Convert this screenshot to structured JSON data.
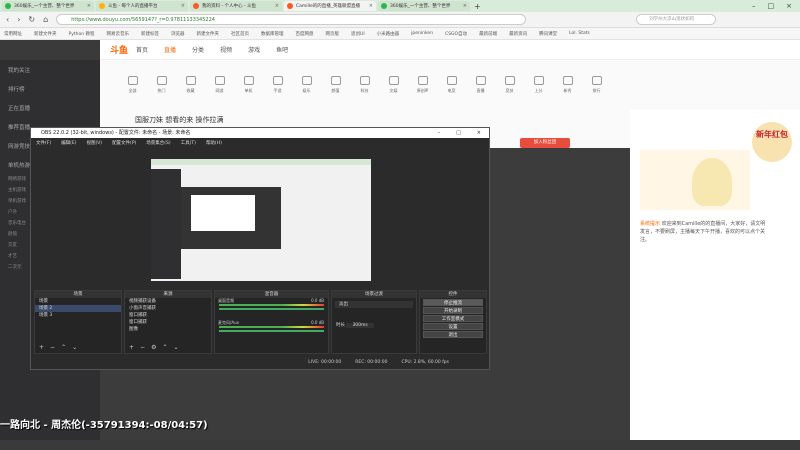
{
  "tabs": [
    {
      "title": "360娱乐_一个主营、整个世界",
      "color": "#2db84d"
    },
    {
      "title": "斗鱼 - 每个人的直播平台",
      "color": "#ffb300"
    },
    {
      "title": "我的资料 - 个人中心 - 斗鱼",
      "color": "#ff5722"
    },
    {
      "title": "Camille的的直播_英雄联盟直播",
      "color": "#ff5722"
    },
    {
      "title": "360娱乐_一个主营、整个世界",
      "color": "#2db84d"
    }
  ],
  "address": {
    "url": "https://www.douyu.com/5659147?_r=0.97811133345224",
    "search_placeholder": "刘学州大凉山现状如何"
  },
  "bookmarks": [
    "常用网址",
    "新建文件夹",
    "Python 教程",
    "网易云音乐",
    "新建标签",
    "浏览器",
    "新建文件夹",
    "社区首页",
    "数据库管理",
    "百度网盘",
    "网页版",
    "思创UI",
    "小米路由器",
    "jpeninken",
    "CSGO自动",
    "最新前端",
    "最新资讯",
    "腾讯课堂",
    "Lol. Stats"
  ],
  "header": {
    "logo": "斗鱼",
    "nav": [
      "首页",
      "直播",
      "分类",
      "视频",
      "游戏",
      "鱼吧"
    ]
  },
  "leftnav": {
    "items": [
      "我的关注",
      "排行榜",
      "正在直播",
      "推荐直播",
      "网游竞技",
      "单机热游"
    ],
    "subs": [
      "网络游戏",
      "主机游戏",
      "单机游戏",
      "户外",
      "音乐电台",
      "颜值",
      "交友",
      "才艺",
      "二次元"
    ]
  },
  "categories": [
    "全部",
    "热门",
    "收藏",
    "网游",
    "单机",
    "手游",
    "娱乐",
    "颜值",
    "科技",
    "文娱",
    "原创IP",
    "电竞",
    "直播",
    "竞技",
    "上分",
    "新秀",
    "排行"
  ],
  "room": {
    "title": "国服刀妹 想看的来 操作拉满",
    "join_label": "加入粉丝团"
  },
  "aside": {
    "badge": "新年红包",
    "notice_title": "系统提示",
    "notice_text": "欢迎来到Camille的的直播间，大家好，请文明发言，不要刷屏，主播每天下午开播，喜欢的可以点个关注。"
  },
  "obs": {
    "title": "OBS 22.0.2 (32-bit, windows) - 配置文件: 未命名 - 场景: 未命名",
    "menu": [
      "文件(F)",
      "编辑(E)",
      "视图(V)",
      "配置文件(P)",
      "场景集合(S)",
      "工具(T)",
      "帮助(H)"
    ],
    "scenes": {
      "header": "场景",
      "items": [
        "场景",
        "场景 2",
        "场景 3"
      ]
    },
    "sources": {
      "header": "来源",
      "items": [
        "视频捕获设备",
        "小窗声音捕获",
        "窗口捕获",
        "窗口捕获",
        "图像"
      ]
    },
    "mixer": {
      "header": "混音器",
      "items": [
        {
          "name": "桌面音频",
          "db": "0.0 dB"
        },
        {
          "name": "麦克风/Aux",
          "db": "0.0 dB"
        }
      ]
    },
    "transitions": {
      "header": "场景过渡",
      "type": "淡出",
      "duration_label": "时长",
      "duration": "300ms"
    },
    "controls": {
      "header": "控件",
      "buttons": [
        "停止推流",
        "开始录制",
        "工作室模式",
        "设置",
        "退出"
      ]
    },
    "status": [
      "LIVE: 00:00:00",
      "REC: 00:00:00",
      "CPU: 2.8%, 60.00 fps"
    ]
  },
  "danmu": "一路向北 - 周杰伦(-35791394:-08/04:57)"
}
